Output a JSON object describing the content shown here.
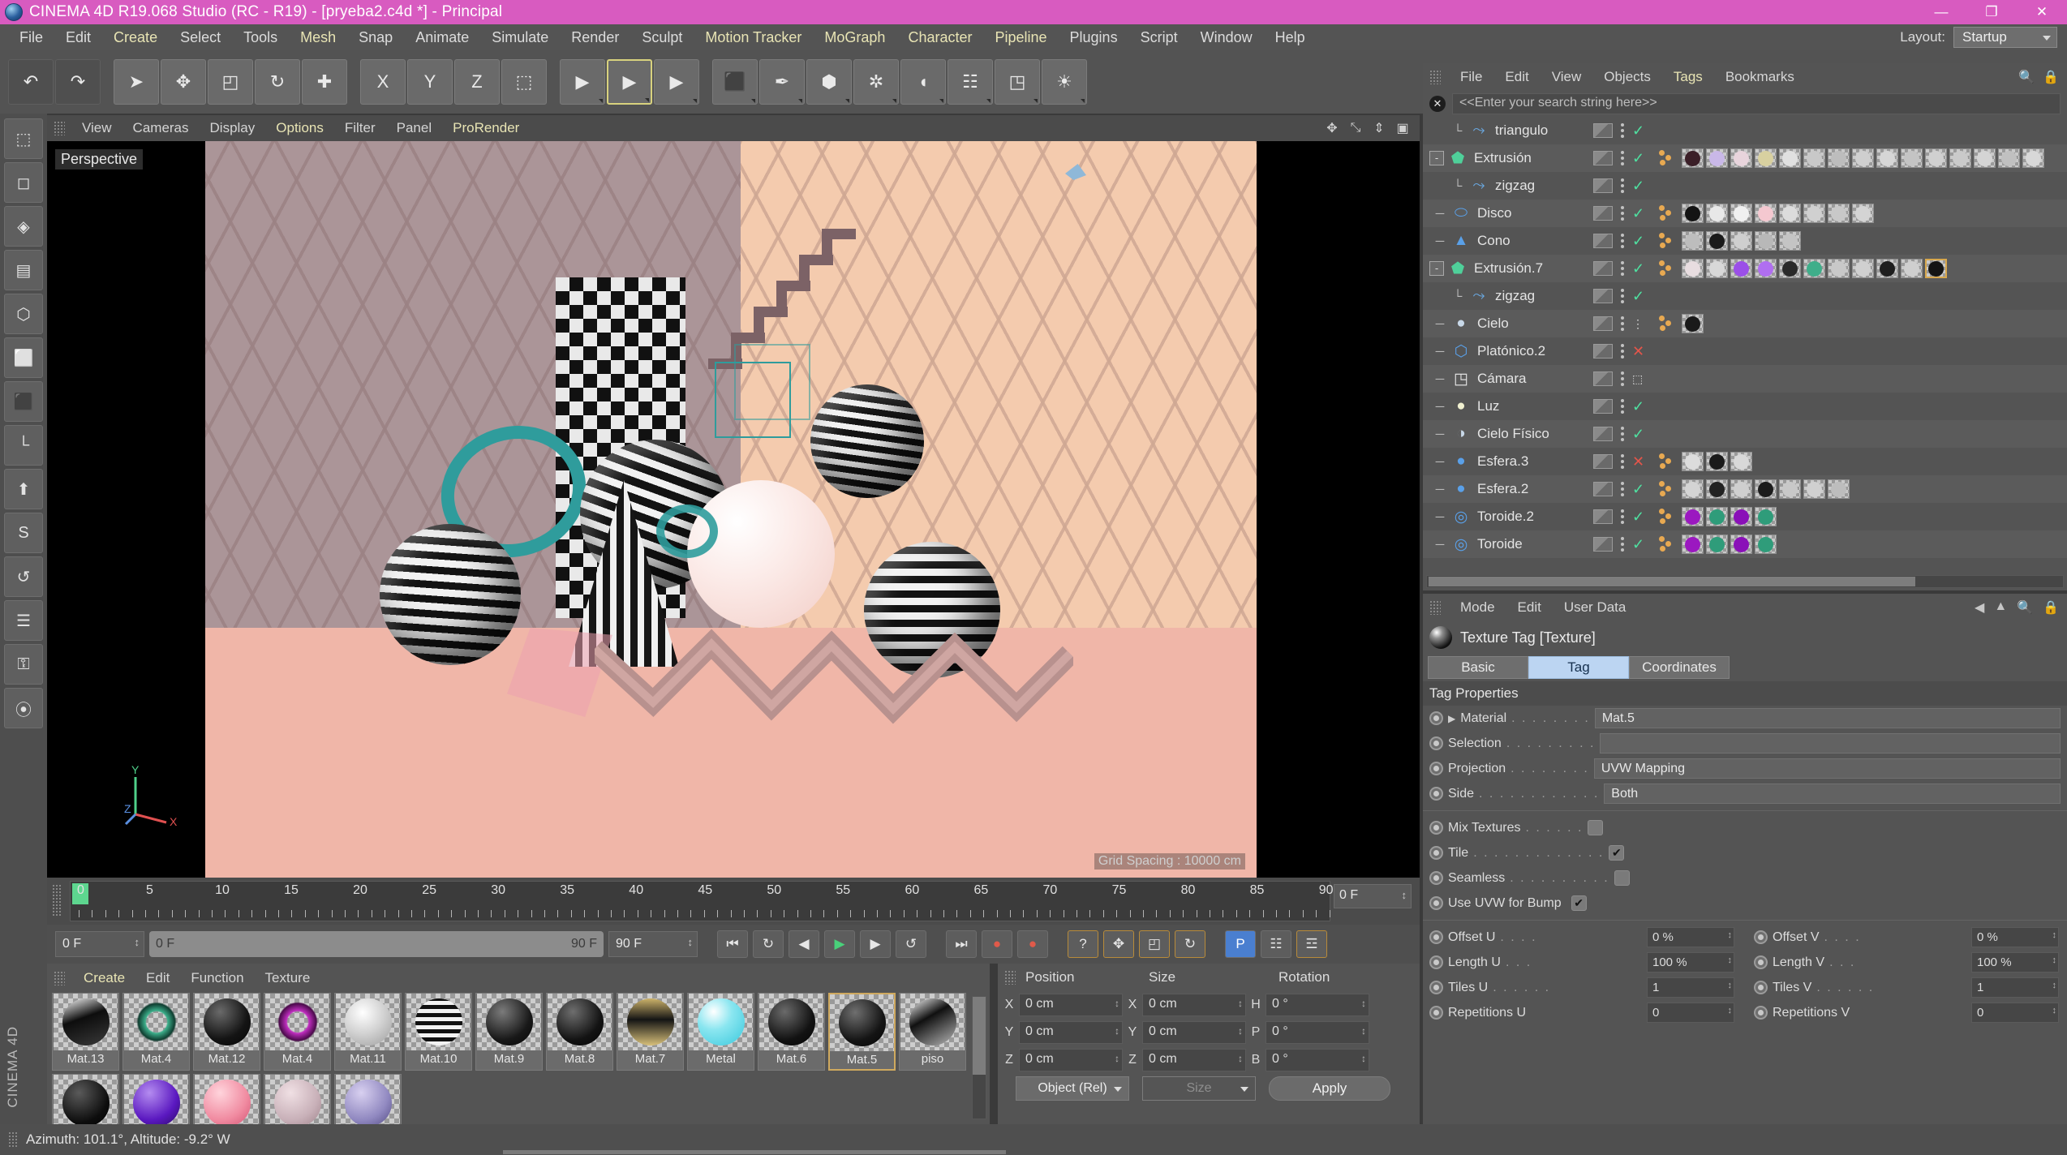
{
  "window": {
    "title": "CINEMA 4D R19.068 Studio (RC - R19) - [pryeba2.c4d *] - Principal",
    "minimize": "—",
    "maximize": "❐",
    "close": "✕"
  },
  "menubar": {
    "items": [
      {
        "label": "File",
        "style": "grey"
      },
      {
        "label": "Edit",
        "style": "grey"
      },
      {
        "label": "Create",
        "style": "gold"
      },
      {
        "label": "Select",
        "style": "grey"
      },
      {
        "label": "Tools",
        "style": "grey"
      },
      {
        "label": "Mesh",
        "style": "gold"
      },
      {
        "label": "Snap",
        "style": "grey"
      },
      {
        "label": "Animate",
        "style": "grey"
      },
      {
        "label": "Simulate",
        "style": "grey"
      },
      {
        "label": "Render",
        "style": "grey"
      },
      {
        "label": "Sculpt",
        "style": "grey"
      },
      {
        "label": "Motion Tracker",
        "style": "gold"
      },
      {
        "label": "MoGraph",
        "style": "gold"
      },
      {
        "label": "Character",
        "style": "gold"
      },
      {
        "label": "Pipeline",
        "style": "gold"
      },
      {
        "label": "Plugins",
        "style": "grey"
      },
      {
        "label": "Script",
        "style": "grey"
      },
      {
        "label": "Window",
        "style": "grey"
      },
      {
        "label": "Help",
        "style": "grey"
      }
    ],
    "layout_label": "Layout:",
    "layout_value": "Startup"
  },
  "toolbar": {
    "buttons": [
      {
        "name": "undo-button",
        "glyph": "↶"
      },
      {
        "name": "redo-button",
        "glyph": "↷"
      },
      {
        "name": "select-tool-button",
        "glyph": "➤"
      },
      {
        "name": "move-tool-button",
        "glyph": "✥"
      },
      {
        "name": "scale-tool-button",
        "glyph": "◰"
      },
      {
        "name": "rotate-tool-button",
        "glyph": "↻"
      },
      {
        "name": "move-axis-button",
        "glyph": "✚"
      },
      {
        "name": "x-axis-button",
        "glyph": "X"
      },
      {
        "name": "y-axis-button",
        "glyph": "Y"
      },
      {
        "name": "z-axis-button",
        "glyph": "Z"
      },
      {
        "name": "world-axis-button",
        "glyph": "⬚"
      },
      {
        "name": "render-view-button",
        "glyph": "▶"
      },
      {
        "name": "render-region-button",
        "glyph": "▶"
      },
      {
        "name": "render-settings-button",
        "glyph": "▶"
      },
      {
        "name": "cube-primitive-button",
        "glyph": "⬛"
      },
      {
        "name": "spline-pen-button",
        "glyph": "✒"
      },
      {
        "name": "array-generator-button",
        "glyph": "⬢"
      },
      {
        "name": "subdivision-surface-button",
        "glyph": "✲"
      },
      {
        "name": "bend-deformer-button",
        "glyph": "◖"
      },
      {
        "name": "floor-environment-button",
        "glyph": "☷"
      },
      {
        "name": "camera-button",
        "glyph": "◳"
      },
      {
        "name": "light-button",
        "glyph": "☀"
      }
    ]
  },
  "left_tools": {
    "buttons": [
      {
        "name": "live-selection-tool",
        "glyph": "⬚"
      },
      {
        "name": "point-mode-tool",
        "glyph": "◻"
      },
      {
        "name": "edge-mode-tool",
        "glyph": "◈"
      },
      {
        "name": "polygon-mode-tool",
        "glyph": "▤"
      },
      {
        "name": "model-mode-tool",
        "glyph": "⬡"
      },
      {
        "name": "object-axis-tool",
        "glyph": "⬜"
      },
      {
        "name": "texture-axis-tool",
        "glyph": "⬛"
      },
      {
        "name": "workplane-tool",
        "glyph": "└"
      },
      {
        "name": "enable-axis-tool",
        "glyph": "⬆"
      },
      {
        "name": "soft-selection-tool",
        "glyph": "S"
      },
      {
        "name": "uv-points-tool",
        "glyph": "↺"
      },
      {
        "name": "uv-polygons-tool",
        "glyph": "☰"
      },
      {
        "name": "lock-tool",
        "glyph": "⚿"
      },
      {
        "name": "snap-tool",
        "glyph": "⦿"
      }
    ],
    "brand": "CINEMA 4D"
  },
  "viewport": {
    "menu": [
      {
        "label": "View",
        "style": "grey"
      },
      {
        "label": "Cameras",
        "style": "grey"
      },
      {
        "label": "Display",
        "style": "grey"
      },
      {
        "label": "Options",
        "style": "gold"
      },
      {
        "label": "Filter",
        "style": "grey"
      },
      {
        "label": "Panel",
        "style": "grey"
      },
      {
        "label": "ProRender",
        "style": "gold"
      }
    ],
    "icons": [
      "pan-icon",
      "zoom-icon",
      "dolly-icon",
      "maximize-icon"
    ],
    "label": "Perspective",
    "grid_spacing": "Grid Spacing : 10000 cm",
    "axis_x": "X",
    "axis_y": "Y",
    "axis_z": "Z"
  },
  "timeline": {
    "ticks": [
      "0",
      "5",
      "10",
      "15",
      "20",
      "25",
      "30",
      "35",
      "40",
      "45",
      "50",
      "55",
      "60",
      "65",
      "70",
      "75",
      "80",
      "85",
      "90"
    ],
    "current_frame_field": "0 F"
  },
  "animation_bar": {
    "start_frame": "0 F",
    "range_left": "0 F",
    "range_right": "90 F",
    "end_frame": "90 F",
    "buttons": [
      {
        "name": "go-to-start-button",
        "glyph": "⏮",
        "style": ""
      },
      {
        "name": "play-loop-button",
        "glyph": "↻",
        "style": ""
      },
      {
        "name": "previous-frame-button",
        "glyph": "◀",
        "style": ""
      },
      {
        "name": "play-button",
        "glyph": "▶",
        "style": "green"
      },
      {
        "name": "next-frame-button",
        "glyph": "▶",
        "style": ""
      },
      {
        "name": "play-reverse-button",
        "glyph": "↺",
        "style": ""
      },
      {
        "name": "go-to-end-button",
        "glyph": "⏭",
        "style": ""
      },
      {
        "name": "record-keyframe-button",
        "glyph": "●",
        "style": "red"
      },
      {
        "name": "autokeying-button",
        "glyph": "●",
        "style": "red"
      },
      {
        "name": "keyframe-help-button",
        "glyph": "?",
        "style": "orange"
      },
      {
        "name": "position-key-button",
        "glyph": "✥",
        "style": "orange"
      },
      {
        "name": "scale-key-button",
        "glyph": "◰",
        "style": "orange"
      },
      {
        "name": "rotation-key-button",
        "glyph": "↻",
        "style": "orange"
      },
      {
        "name": "pla-key-button",
        "glyph": "P",
        "style": "blue"
      },
      {
        "name": "parameter-key-button",
        "glyph": "☷",
        "style": ""
      },
      {
        "name": "timeline-toggle-button",
        "glyph": "☲",
        "style": "orange"
      }
    ]
  },
  "material_manager": {
    "menu": [
      {
        "label": "Create",
        "style": "gold"
      },
      {
        "label": "Edit",
        "style": "grey"
      },
      {
        "label": "Function",
        "style": "grey"
      },
      {
        "label": "Texture",
        "style": "grey"
      }
    ],
    "materials": [
      {
        "name": "Mat.13",
        "color": "linear-gradient(160deg,#ffffff 0%,#0d0d0d 42%,#3a3a3a 100%)",
        "selected": false
      },
      {
        "name": "Mat.4",
        "color": "radial-gradient(circle at 50% 50%, transparent 30%, #3cae8a 34%, #0f3d30 55%, transparent 60%)",
        "selected": false
      },
      {
        "name": "Mat.12",
        "color": "radial-gradient(circle at 35% 28%, #6a6a6a 0%, #141414 60%, #050505 100%)",
        "selected": false
      },
      {
        "name": "Mat.4",
        "color": "radial-gradient(circle at 50% 50%, transparent 30%, #c02ec0 34%, #4a0a4a 56%, transparent 60%)",
        "selected": false
      },
      {
        "name": "Mat.11",
        "color": "radial-gradient(circle at 38% 30%, #ffffff 0%, #d2d2d2 48%, #9c9c9c 100%)",
        "selected": false
      },
      {
        "name": "Mat.10",
        "color": "repeating-linear-gradient(0deg,#f2f2f2 0 5px,#111 5px 10px)",
        "selected": false
      },
      {
        "name": "Mat.9",
        "color": "radial-gradient(circle at 35% 28%, #7b7b7b 0%, #181818 62%, #060606 100%)",
        "selected": false
      },
      {
        "name": "Mat.8",
        "color": "radial-gradient(circle at 35% 28%, #6e6e6e 0%, #131313 62%, #040404 100%)",
        "selected": false
      },
      {
        "name": "Mat.7",
        "color": "linear-gradient(180deg,#cdb36a 0%,#141414 45%,#d8c07a 100%)",
        "selected": false
      },
      {
        "name": "Metal",
        "color": "radial-gradient(circle at 34% 28%, #ffffff 0%, #8ae6f0 40%, #39c8dc 100%)",
        "selected": false
      },
      {
        "name": "Mat.6",
        "color": "radial-gradient(circle at 35% 28%, #6a6a6a 0%, #121212 62%, #050505 100%)",
        "selected": false
      },
      {
        "name": "Mat.5",
        "color": "radial-gradient(circle at 35% 28%, #6f6f6f 0%, #141414 62%, #060606 100%)",
        "selected": true
      },
      {
        "name": "piso",
        "color": "linear-gradient(150deg,#ffffff 0%,#101010 40%,#b9b9b9 100%)",
        "selected": false
      },
      {
        "name": "",
        "color": "radial-gradient(circle at 35% 28%, #5a5a5a 0%, #0d0d0d 65%, #000 100%)",
        "selected": false
      },
      {
        "name": "",
        "color": "radial-gradient(circle at 35% 28%, #b48cf0 0%, #5a18c0 60%, #280a60 100%)",
        "selected": false
      },
      {
        "name": "",
        "color": "radial-gradient(circle at 35% 28%, #ffd4dc 0%, #f08aa0 60%, #d05070 100%)",
        "selected": false
      },
      {
        "name": "",
        "color": "radial-gradient(circle at 35% 28%, #f0e0e4 0%, #c8b0b8 60%, #9c8088 100%)",
        "selected": false
      },
      {
        "name": "",
        "color": "radial-gradient(circle at 35% 28%, #d8d0f0 0%, #9088c0 60%, #504880 100%)",
        "selected": false
      }
    ]
  },
  "coordinates": {
    "headers": [
      "Position",
      "Size",
      "Rotation"
    ],
    "rows": [
      {
        "axis_pos": "X",
        "pos": "0 cm",
        "axis_size": "X",
        "size": "0 cm",
        "axis_rot": "H",
        "rot": "0 °"
      },
      {
        "axis_pos": "Y",
        "pos": "0 cm",
        "axis_size": "Y",
        "size": "0 cm",
        "axis_rot": "P",
        "rot": "0 °"
      },
      {
        "axis_pos": "Z",
        "pos": "0 cm",
        "axis_size": "Z",
        "size": "0 cm",
        "axis_rot": "B",
        "rot": "0 °"
      }
    ],
    "mode_dropdown": "Object (Rel)",
    "size_dropdown": "Size",
    "apply_button": "Apply"
  },
  "object_manager": {
    "menu": [
      {
        "label": "File",
        "style": "grey"
      },
      {
        "label": "Edit",
        "style": "grey"
      },
      {
        "label": "View",
        "style": "grey"
      },
      {
        "label": "Objects",
        "style": "grey"
      },
      {
        "label": "Tags",
        "style": "gold"
      },
      {
        "label": "Bookmarks",
        "style": "grey"
      }
    ],
    "search_placeholder": "<<Enter your search string here>>",
    "objects": [
      {
        "label": "triangulo",
        "indent": 2,
        "icon": "spline-icon",
        "icon_color": "#6aa8e0",
        "expander": "",
        "enable": "check",
        "tags": []
      },
      {
        "label": "Extrusión",
        "indent": 1,
        "icon": "extrude-icon",
        "icon_color": "#4fd09a",
        "expander": "-",
        "enable": "check",
        "tags": [
          "#3b1f28",
          "#c9b8e8",
          "#e8d4dc",
          "#d8d0a0",
          "#e0e0e0",
          "#c8c8c8",
          "#bdbdbd",
          "#cfcfcf",
          "#d6d6d6",
          "#c4c4c4",
          "#d0d0d0",
          "#cacaca",
          "#d4d4d4",
          "#c0c0c0",
          "#d8d8d8"
        ]
      },
      {
        "label": "zigzag",
        "indent": 2,
        "icon": "spline-icon",
        "icon_color": "#6aa8e0",
        "expander": "",
        "enable": "check",
        "tags": []
      },
      {
        "label": "Disco",
        "indent": 1,
        "icon": "disc-icon",
        "icon_color": "#5aa0e8",
        "expander": "",
        "enable": "check",
        "tags": [
          "#141414",
          "#e8e8e8",
          "#f0f0f0",
          "#f4c8d0",
          "#dcdcdc",
          "#d0d0d0",
          "#c8c8c8",
          "#d4d4d4"
        ]
      },
      {
        "label": "Cono",
        "indent": 1,
        "icon": "cone-icon",
        "icon_color": "#5aa0e8",
        "expander": "",
        "enable": "check",
        "tags": [
          "#bdbdbd",
          "#1a1a1a",
          "#cfcfcf",
          "#b8b8b8",
          "#c4c4c4"
        ]
      },
      {
        "label": "Extrusión.7",
        "indent": 1,
        "icon": "extrude-icon",
        "icon_color": "#4fd09a",
        "expander": "-",
        "enable": "check",
        "tags": [
          "#e8dde0",
          "#d8d8d8",
          "#9b4fe8",
          "#b06ef0",
          "#2a2a2a",
          "#3fae8a",
          "#c8c8c8",
          "#d0d0d0",
          "#1e1e1e",
          "#cfcfcf",
          "#141414"
        ]
      },
      {
        "label": "zigzag",
        "indent": 2,
        "icon": "spline-icon",
        "icon_color": "#6aa8e0",
        "expander": "",
        "enable": "check",
        "tags": []
      },
      {
        "label": "Cielo",
        "indent": 1,
        "icon": "sky-icon",
        "icon_color": "#c8d8e8",
        "expander": "",
        "enable": "dash",
        "tags": [
          "#1a1a1a"
        ]
      },
      {
        "label": "Platónico.2",
        "indent": 1,
        "icon": "platonic-icon",
        "icon_color": "#5aa0e8",
        "expander": "",
        "enable": "x",
        "tags": []
      },
      {
        "label": "Cámara",
        "indent": 1,
        "icon": "camera-icon",
        "icon_color": "#e8e8e8",
        "expander": "",
        "enable": "dots",
        "tags": []
      },
      {
        "label": "Luz",
        "indent": 1,
        "icon": "light-icon",
        "icon_color": "#f0f0d0",
        "expander": "",
        "enable": "check",
        "tags": []
      },
      {
        "label": "Cielo Físico",
        "indent": 1,
        "icon": "physical-sky-icon",
        "icon_color": "#c8d8e8",
        "expander": "",
        "enable": "check",
        "tags": []
      },
      {
        "label": "Esfera.3",
        "indent": 1,
        "icon": "sphere-icon",
        "icon_color": "#5aa0e8",
        "expander": "",
        "enable": "x",
        "tags": [
          "#dcdcdc",
          "#1a1a1a",
          "#d8d8d8"
        ]
      },
      {
        "label": "Esfera.2",
        "indent": 1,
        "icon": "sphere-icon",
        "icon_color": "#5aa0e8",
        "expander": "",
        "enable": "check",
        "tags": [
          "#d4d4d4",
          "#222222",
          "#cfcfcf",
          "#1c1c1c",
          "#c8c8c8",
          "#d0d0d0",
          "#bdbdbd"
        ]
      },
      {
        "label": "Toroide.2",
        "indent": 1,
        "icon": "torus-icon",
        "icon_color": "#5aa0e8",
        "expander": "",
        "enable": "check",
        "tags": [
          "#9b18c0",
          "#2f9c7a",
          "#8a10b8",
          "#2f9c7a"
        ]
      },
      {
        "label": "Toroide",
        "indent": 1,
        "icon": "torus-icon",
        "icon_color": "#5aa0e8",
        "expander": "",
        "enable": "check",
        "tags": [
          "#9b18c0",
          "#2f9c7a",
          "#8a10b8",
          "#2f9c7a"
        ]
      }
    ]
  },
  "attribute_manager": {
    "menu": [
      "Mode",
      "Edit",
      "User Data"
    ],
    "title": "Texture Tag [Texture]",
    "tabs": [
      {
        "label": "Basic",
        "active": false
      },
      {
        "label": "Tag",
        "active": true
      },
      {
        "label": "Coordinates",
        "active": false
      }
    ],
    "section": "Tag Properties",
    "properties": [
      {
        "label": "Material",
        "dots": ". . . . . . . .",
        "value": "Mat.5",
        "type": "text",
        "arrow": true
      },
      {
        "label": "Selection",
        "dots": ". . . . . . . . .",
        "value": "",
        "type": "text",
        "arrow": false
      },
      {
        "label": "Projection",
        "dots": ". . . . . . . .",
        "value": "UVW Mapping",
        "type": "text",
        "arrow": false
      },
      {
        "label": "Side",
        "dots": ". . . . . . . . . . . .",
        "value": "Both",
        "type": "text",
        "arrow": false
      }
    ],
    "checkboxes": [
      {
        "label": "Mix Textures",
        "dots": ". . . . . .",
        "checked": false
      },
      {
        "label": "Tile",
        "dots": ". . . . . . . . . . . . .",
        "checked": true
      },
      {
        "label": "Seamless",
        "dots": ". . . . . . . . . .",
        "checked": false
      },
      {
        "label": "Use UVW for Bump",
        "dots": "",
        "checked": true
      }
    ],
    "uv_rows": [
      {
        "label_u": "Offset U",
        "dots_u": ". . . .",
        "value_u": "0 %",
        "label_v": "Offset V",
        "dots_v": ". . . .",
        "value_v": "0 %"
      },
      {
        "label_u": "Length U",
        "dots_u": ". . .",
        "value_u": "100 %",
        "label_v": "Length V",
        "dots_v": ". . .",
        "value_v": "100 %"
      },
      {
        "label_u": "Tiles U",
        "dots_u": ". . . . . .",
        "value_u": "1",
        "label_v": "Tiles V",
        "dots_v": ". . . . . .",
        "value_v": "1"
      },
      {
        "label_u": "Repetitions U",
        "dots_u": "",
        "value_u": "0",
        "label_v": "Repetitions V",
        "dots_v": "",
        "value_v": "0"
      }
    ]
  },
  "statusbar": {
    "text": "Azimuth: 101.1°, Altitude: -9.2°  W"
  },
  "colors": {
    "titlebar": "#d85bc0",
    "panel": "#545454",
    "accent_gold": "#e8e4b4",
    "active_tab": "#bcd5f2"
  }
}
